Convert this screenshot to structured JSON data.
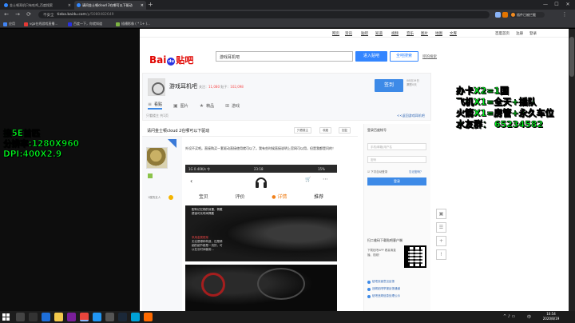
{
  "browser": {
    "tabs": [
      {
        "label": "金士顿耳机只有吃鸡_百度搜索",
        "active": false
      },
      {
        "label": "请问金士顿cloud 2在哪可以下驱动",
        "active": true
      }
    ],
    "new_tab": "+",
    "window_controls": {
      "minimize": "—",
      "maximize": "☐",
      "close": "✕"
    },
    "nav": {
      "back": "←",
      "forward": "→",
      "reload": "⟳"
    },
    "address": {
      "warning": "不安全",
      "host": "tieba.baidu.com",
      "path": "/p/5080482649"
    },
    "sync_label": "插件已被拦截",
    "bookmarks": [
      "应用",
      "vga在线游戏直播…",
      "百度一下，你就知道",
      "插槽影像 ( * 1+ )..."
    ]
  },
  "toplinks": [
    "网页",
    "资讯",
    "贴吧",
    "知道",
    "视频",
    "音乐",
    "图片",
    "地图",
    "文库"
  ],
  "toplinks_right": [
    "百度首页",
    "注册",
    "登录"
  ],
  "logo": {
    "bai": "Bai",
    "paw": "du",
    "tb": "贴吧"
  },
  "search": {
    "value": "游戏耳机吧",
    "enter_label": "进入贴吧",
    "global_label": "全吧搜索",
    "create_label": "吧的搜索"
  },
  "forum": {
    "name": "游戏耳机吧",
    "stats_prefix_1": "关注：",
    "followers": "11,080",
    "stats_prefix_2": "贴子：",
    "posts": "102,098",
    "signin_label": "签到",
    "signin_info": [
      "08月19日",
      "漏签0天"
    ],
    "tabs": [
      {
        "icon": "≡",
        "label": "看贴",
        "active": true
      },
      {
        "icon": "▣",
        "label": "图片",
        "active": false
      },
      {
        "icon": "★",
        "label": "精品",
        "active": false
      },
      {
        "icon": "⊞",
        "label": "游戏",
        "active": false
      }
    ]
  },
  "crumb": "只看楼主  共1页",
  "more_link": "<<返回游戏耳机吧",
  "post": {
    "title": "请问金士顿cloud 2在哪可以下驱动",
    "buttons": [
      "只看楼主",
      "收藏",
      "回复"
    ],
    "user_level_label": "1楼的友人",
    "text": "外设不买吧。直接购买一套驱动直接使用就可以了。我有些时候直接说明上官网可以用，但是我都是问的！"
  },
  "phone": {
    "status_left": "1G 0.40K/s 令",
    "status_time": "23:18",
    "status_right": "15%",
    "tabs": [
      {
        "label": "宝贝",
        "active": false
      },
      {
        "label": "评价",
        "active": false
      },
      {
        "label": "详情",
        "active": true
      },
      {
        "label": "推荐",
        "active": false
      }
    ],
    "caption_1": "配有记忆棉的耳罩，佩戴舒适可长时间佩戴",
    "caption_red": "采用金属框架",
    "caption_2": "无论是哪种构造，还是精细的细节都是一流的，可以在长时间使用…"
  },
  "sidebar": {
    "title": "登录百度帐号",
    "username_placeholder": "手机/邮箱/用户名",
    "password_placeholder": "密码",
    "remember": "下次自动登录",
    "forgot": "忘记密码？",
    "login": "登录",
    "qr_title": "扫二维码下载贴吧客户端",
    "qr_text": "下载贴吧APP 看高清直播、视频！",
    "links": [
      "贴吧页面意见反馈",
      "违规贴吧举报反馈通道",
      "贴吧违规信息处理公示"
    ]
  },
  "float_buttons": [
    "▣",
    "☰",
    "+",
    "!"
  ],
  "overlay_left": [
    "接5E首匹",
    "分辨率:1280X960",
    "DPI:400X2.9"
  ],
  "overlay_right": [
    "办卡X2=1国",
    "飞机X1=全天+插队",
    "火箭X1=房管+永久车位",
    "水友群：  65234582"
  ],
  "taskbar": {
    "time": "10:54",
    "date": "2020/8/19",
    "lang": "中",
    "tray": "^ ♪ ▭"
  },
  "colors": {
    "accent": "#3385ff",
    "overlay": "#00ff1e",
    "red": "#e10602"
  }
}
